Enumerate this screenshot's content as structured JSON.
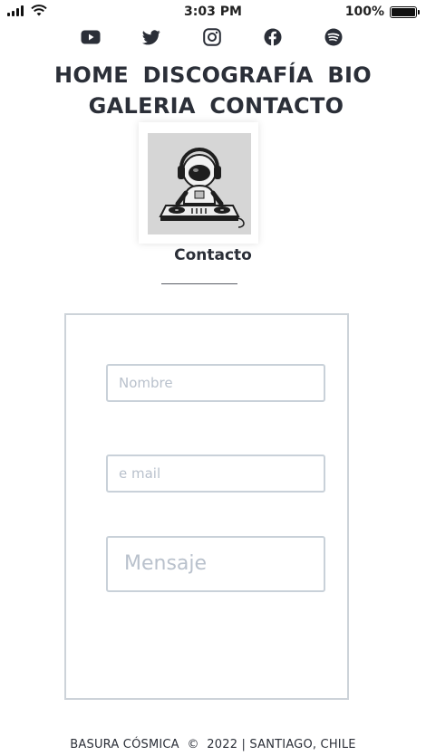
{
  "status_bar": {
    "time": "3:03 PM",
    "battery_percent": "100%",
    "battery_level": 1.0
  },
  "social": {
    "icons": [
      "youtube-icon",
      "twitter-icon",
      "instagram-icon",
      "facebook-icon",
      "spotify-icon"
    ]
  },
  "nav": {
    "items": [
      "HOME",
      "DISCOGRAFÍA",
      "BIO",
      "GALERIA",
      "CONTACTO"
    ]
  },
  "section": {
    "title": "Contacto"
  },
  "form": {
    "name_placeholder": "Nombre",
    "email_placeholder": "e mail",
    "message_placeholder": "Mensaje"
  },
  "footer": {
    "text": "BASURA CÓSMICA  ©  2022 | SANTIAGO, CHILE"
  }
}
